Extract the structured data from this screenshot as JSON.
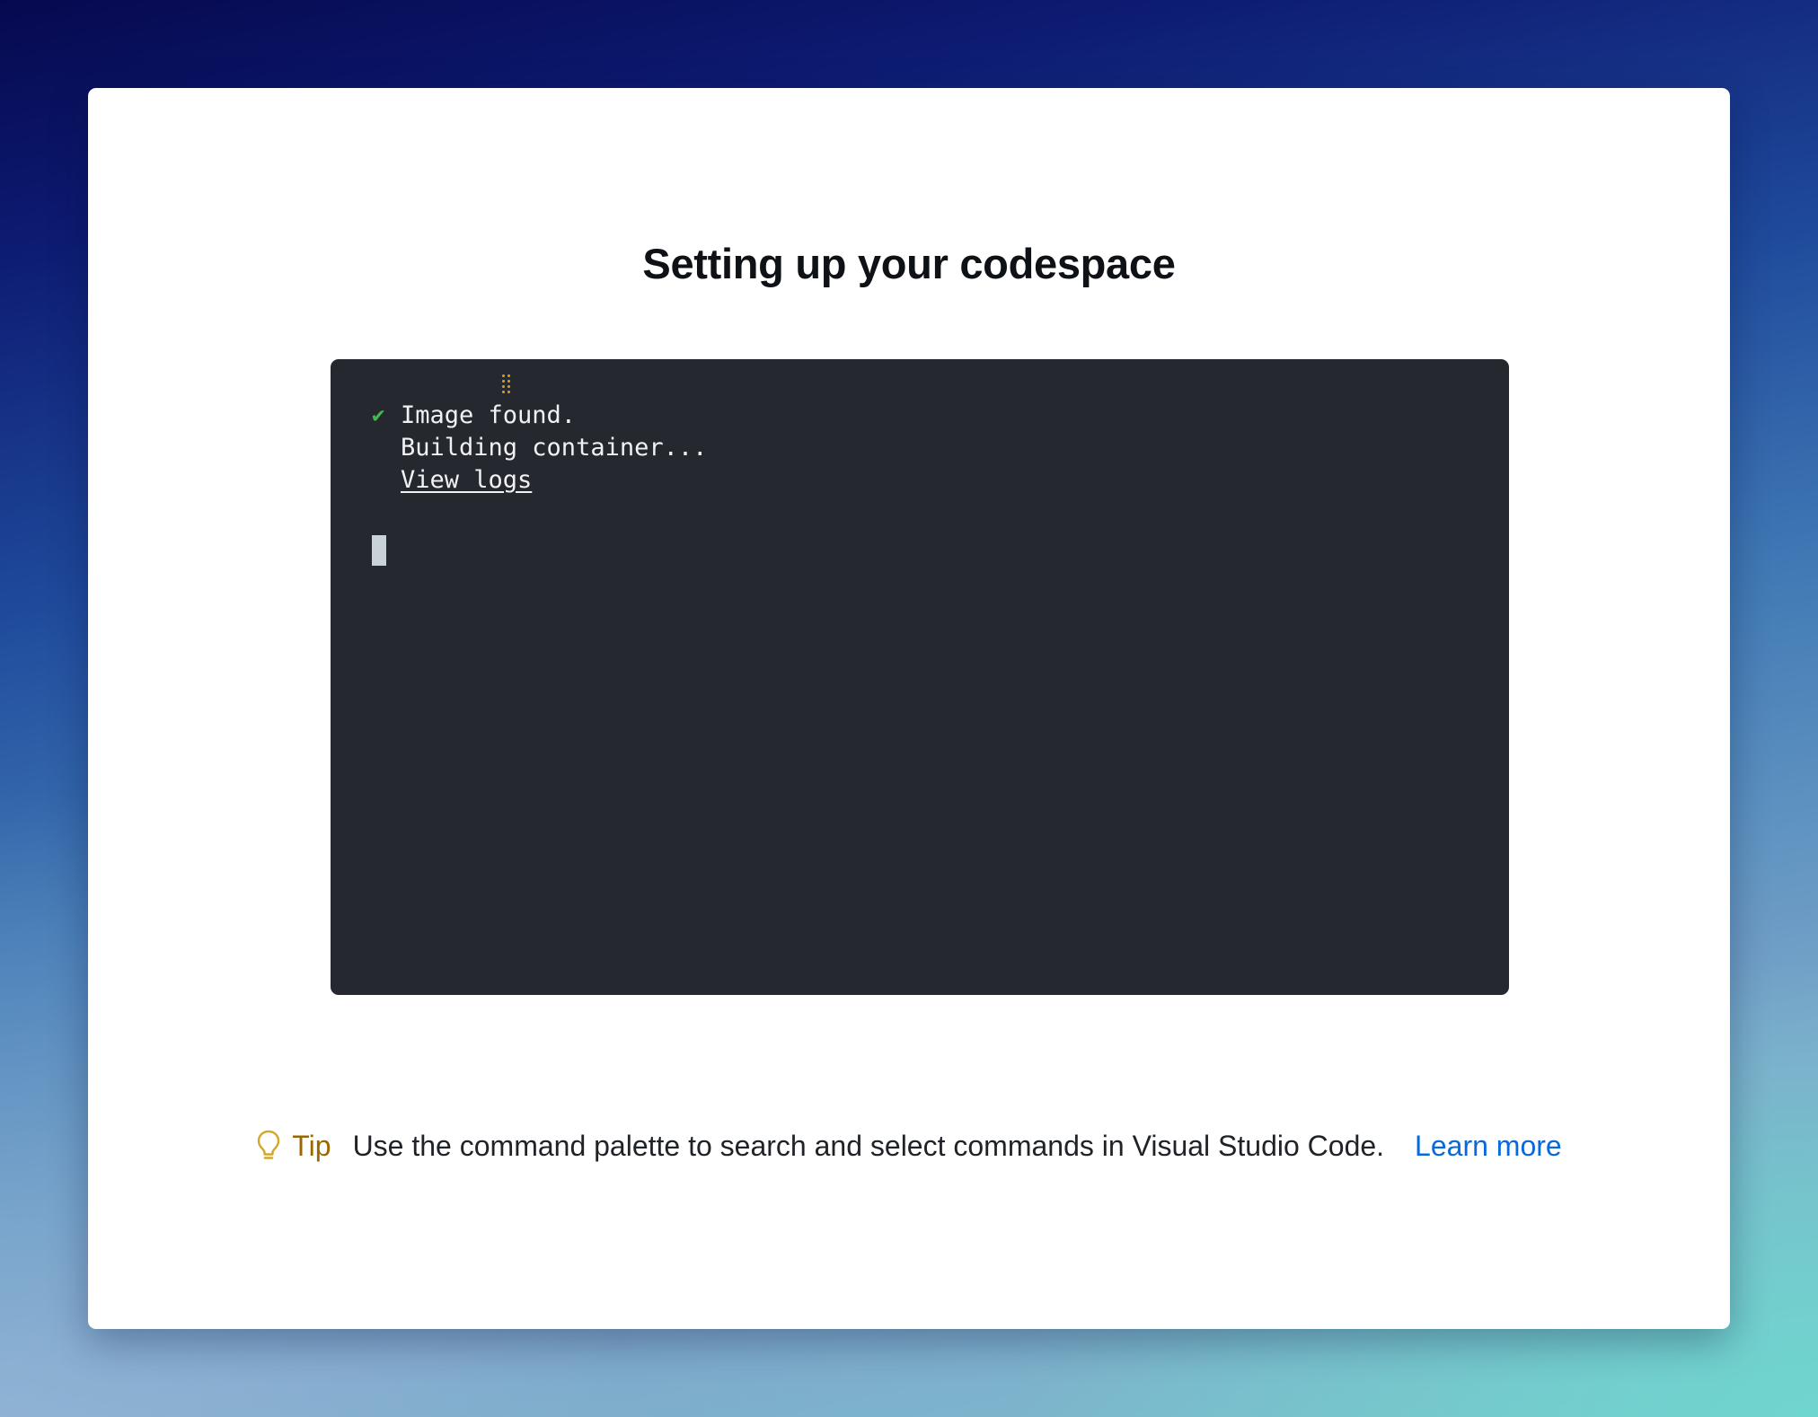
{
  "page": {
    "title": "Setting up your codespace"
  },
  "terminal": {
    "lines": [
      {
        "status": "done",
        "icon": "check-icon",
        "text": "Image found."
      },
      {
        "status": "in-progress",
        "icon": "spinner-icon",
        "text": "Building container..."
      }
    ],
    "view_logs_label": "View logs",
    "cursor": "block-cursor"
  },
  "tip": {
    "icon": "lightbulb-icon",
    "label": "Tip",
    "text": "Use the command palette to search and select commands in Visual Studio Code.",
    "link_label": "Learn more"
  },
  "colors": {
    "success": "#3fb950",
    "progress": "#e3a008",
    "tip_label": "#9a6700",
    "link": "#0969da",
    "terminal_bg": "#25282e"
  }
}
